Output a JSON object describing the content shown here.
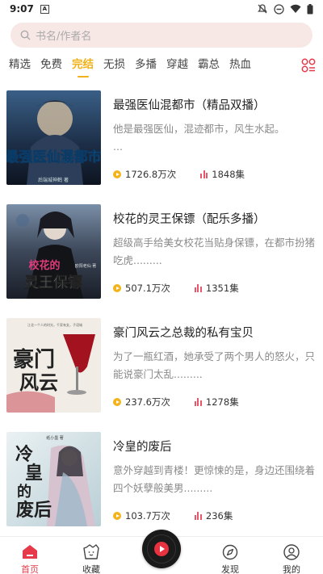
{
  "status_bar": {
    "time": "9:07",
    "notification_badge": "A",
    "icons": [
      "mute-icon",
      "dnd-icon",
      "wifi-icon",
      "battery-icon"
    ]
  },
  "search": {
    "placeholder": "书名/作者名"
  },
  "tabs": {
    "items": [
      {
        "label": "精选",
        "active": false
      },
      {
        "label": "免费",
        "active": false
      },
      {
        "label": "完结",
        "active": true
      },
      {
        "label": "无损",
        "active": false
      },
      {
        "label": "多播",
        "active": false
      },
      {
        "label": "穿越",
        "active": false
      },
      {
        "label": "霸总",
        "active": false
      },
      {
        "label": "热血",
        "active": false
      }
    ],
    "more_icon": "category-grid-icon",
    "accent_color": "#f0b21a"
  },
  "books": [
    {
      "title": "最强医仙混都市（精品双播）",
      "desc": "他是最强医仙，混迹都市，风生水起。",
      "desc2": "...",
      "plays": "1726.8万次",
      "episodes": "1848集",
      "cover_text": "最强医仙混都市",
      "cover_small": "后端城神鹤   著"
    },
    {
      "title": "校花的灵王保镖（配乐多播）",
      "desc": "超级高手给美女校花当贴身保镖，在都市扮猪吃虎.........",
      "plays": "507.1万次",
      "episodes": "1351集",
      "cover_text": "校花的灵王保镖",
      "cover_small": "欧阳老仙 著"
    },
    {
      "title": "豪门风云之总裁的私有宝贝",
      "desc": "为了一瓶红酒，她承受了两个男人的怒火，只能说豪门太乱.........",
      "plays": "237.6万次",
      "episodes": "1278集",
      "cover_text": "豪门风云",
      "cover_small": "江北一个人的时光，千家有女，子语城"
    },
    {
      "title": "冷皇的废后",
      "desc": "意外穿越到青楼！更惊悚的是，身边还围绕着四个妖孽般美男.........",
      "plays": "103.7万次",
      "episodes": "236集",
      "cover_text": "冷皇的废后",
      "cover_small": "纸小墨 著"
    }
  ],
  "bottom_nav": {
    "items": [
      {
        "label": "首页",
        "icon": "home-icon",
        "active": true
      },
      {
        "label": "收藏",
        "icon": "favorites-icon",
        "active": false
      },
      {
        "label": "发现",
        "icon": "discover-icon",
        "active": false
      },
      {
        "label": "我的",
        "icon": "profile-icon",
        "active": false
      }
    ],
    "center_icon": "player-disc-icon",
    "active_color": "#e63a4a"
  }
}
